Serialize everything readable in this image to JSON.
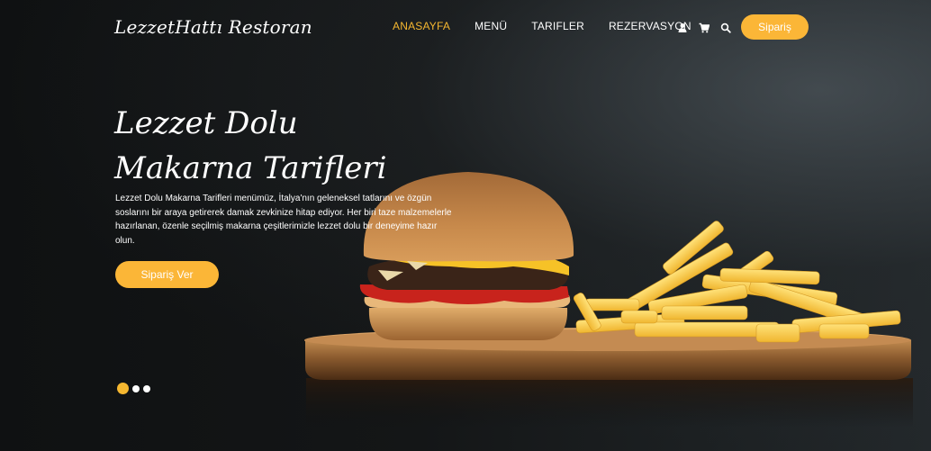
{
  "brand": "LezzetHattı Restoran",
  "nav": {
    "items": [
      "ANASAYFA",
      "MENÜ",
      "TARIFLER",
      "REZERVASYON"
    ],
    "active_index": 0,
    "icons": [
      "user-icon",
      "cart-icon",
      "search-icon"
    ],
    "order_label": "Sipariş"
  },
  "hero": {
    "title": "Lezzet Dolu Makarna Tarifleri",
    "description": "Lezzet Dolu Makarna Tarifleri menümüz, İtalya'nın geleneksel tatlarını ve özgün soslarını bir araya getirerek damak zevkinize hitap ediyor. Her biri taze malzemelerle hazırlanan, özenle seçilmiş makarna çeşitlerimizle lezzet dolu bir deneyime hazır olun.",
    "cta_label": "Sipariş Ver"
  },
  "slider": {
    "count": 3,
    "active": 1
  },
  "colors": {
    "accent": "#fbb637",
    "active_nav": "#f5b730",
    "background": "#0f1112",
    "text": "#ffffff"
  }
}
